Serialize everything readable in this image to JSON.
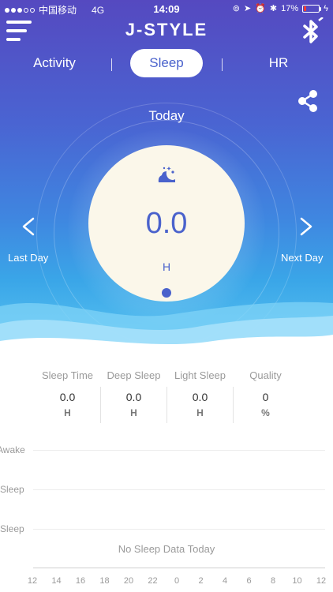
{
  "status_bar": {
    "carrier": "中国移动",
    "network": "4G",
    "time": "14:09",
    "battery": "17%"
  },
  "header": {
    "brand": "J-STYLE",
    "icons": [
      "menu-icon",
      "bluetooth-icon",
      "share-icon"
    ]
  },
  "tabs": [
    {
      "label": "Activity",
      "active": false
    },
    {
      "label": "Sleep",
      "active": true
    },
    {
      "label": "HR",
      "active": false
    }
  ],
  "day_panel": {
    "title": "Today",
    "value": "0.0",
    "unit": "H",
    "prev_label": "Last Day",
    "next_label": "Next Day",
    "icon": "moon-sleep-icon"
  },
  "stats": [
    {
      "label": "Sleep Time",
      "value": "0.0",
      "unit": "H"
    },
    {
      "label": "Deep Sleep",
      "value": "0.0",
      "unit": "H"
    },
    {
      "label": "Light Sleep",
      "value": "0.0",
      "unit": "H"
    },
    {
      "label": "Quality",
      "value": "0",
      "unit": "%"
    }
  ],
  "chart_data": {
    "type": "bar",
    "categories": [
      "Awake",
      "Sleep",
      "Sleep"
    ],
    "x_ticks": [
      "12",
      "14",
      "16",
      "18",
      "20",
      "22",
      "0",
      "2",
      "4",
      "6",
      "8",
      "10",
      "12"
    ],
    "empty_message": "No Sleep Data Today"
  },
  "colors": {
    "accent": "#4a62cc",
    "gradient_top": "#5549c0",
    "gradient_bottom": "#5cc6f2",
    "disc": "#fbf7ea"
  }
}
